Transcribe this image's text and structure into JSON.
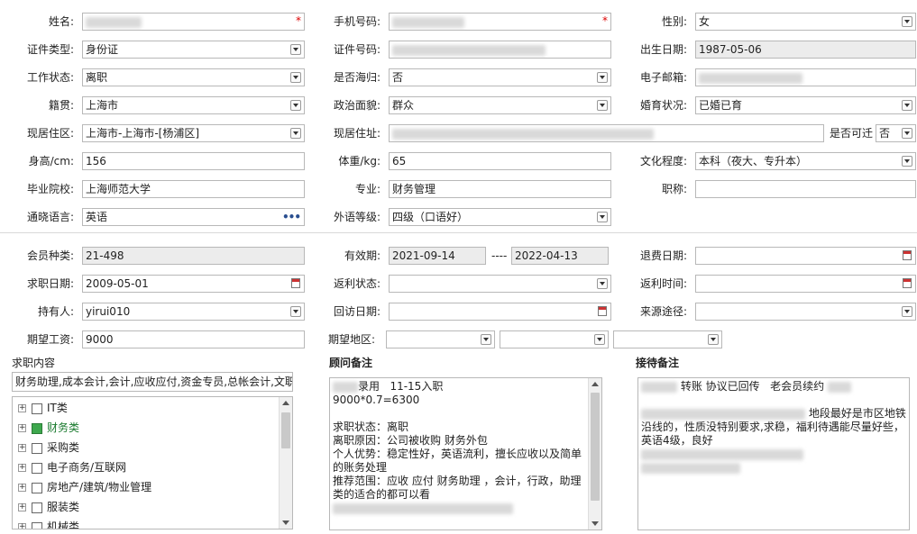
{
  "labels": {
    "name": "姓名:",
    "mobile": "手机号码:",
    "gender": "性别:",
    "id_type": "证件类型:",
    "id_no": "证件号码:",
    "birth": "出生日期:",
    "work_status": "工作状态:",
    "returnee": "是否海归:",
    "email": "电子邮箱:",
    "native": "籍贯:",
    "political": "政治面貌:",
    "marital": "婚育状况:",
    "residence": "现居住区:",
    "address": "现居住址:",
    "relocate": "是否可迁",
    "height": "身高/cm:",
    "weight": "体重/kg:",
    "education": "文化程度:",
    "school": "毕业院校:",
    "major": "专业:",
    "title": "职称:",
    "language": "通晓语言:",
    "lang_level": "外语等级:",
    "member_type": "会员种类:",
    "validity": "有效期:",
    "refund_date": "退费日期:",
    "job_date": "求职日期:",
    "rebate_status": "返利状态:",
    "rebate_time": "返利时间:",
    "holder": "持有人:",
    "visit_date": "回访日期:",
    "source": "来源途径:",
    "salary": "期望工资:",
    "area": "期望地区:"
  },
  "values": {
    "gender": "女",
    "id_type": "身份证",
    "birth": "1987-05-06",
    "work_status": "离职",
    "returnee": "否",
    "native": "上海市",
    "political": "群众",
    "marital": "已婚已育",
    "residence": "上海市-上海市-[杨浦区]",
    "relocate": "否",
    "height": "156",
    "weight": "65",
    "education": "本科（夜大、专升本）",
    "school": "上海师范大学",
    "major": "财务管理",
    "title": "",
    "language": "英语",
    "lang_level": "四级（口语好）",
    "member_type": "21-498",
    "validity_start": "2021-09-14",
    "validity_sep": "----",
    "validity_end": "2022-04-13",
    "refund_date": "",
    "job_date": "2009-05-01",
    "rebate_status": "",
    "rebate_time": "",
    "holder": "yirui010",
    "visit_date": "",
    "source": "",
    "salary": "9000"
  },
  "sections": {
    "job_content": "求职内容",
    "consultant_note": "顾问备注",
    "reception_note": "接待备注"
  },
  "job_content_summary": "财务助理,成本会计,会计,应收应付,资金专员,总帐会计,文职",
  "job_tree": [
    {
      "label": "IT类",
      "checked": false
    },
    {
      "label": "财务类",
      "checked": true
    },
    {
      "label": "采购类",
      "checked": false
    },
    {
      "label": "电子商务/互联网",
      "checked": false
    },
    {
      "label": "房地产/建筑/物业管理",
      "checked": false
    },
    {
      "label": "服装类",
      "checked": false
    },
    {
      "label": "机械类",
      "checked": false
    }
  ],
  "consultant_note": {
    "line1_suffix": "录用   11-15入职",
    "body": "9000*0.7=6300\n\n求职状态：离职\n离职原因：公司被收购 财务外包\n个人优势：稳定性好，英语流利，擅长应收以及简单的账务处理\n推荐范围：应收 应付 财务助理 ，会计，行政，助理类的适合的都可以看"
  },
  "reception_note": {
    "line1": "转账 协议已回传   老会员续约",
    "line2_suffix": "地段最好是市区地铁沿线的，性质没特别要求,求稳，福利待遇能尽量好些，英语4级，良好"
  },
  "icons": {
    "required": "*",
    "more": "•••"
  }
}
